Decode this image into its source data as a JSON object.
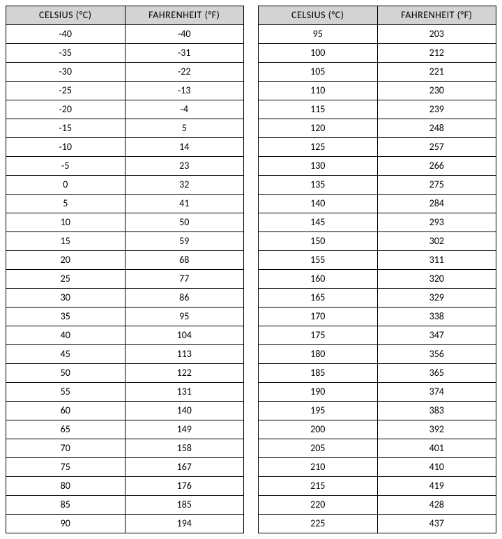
{
  "headers": {
    "celsius": "CELSIUS (°C)",
    "fahrenheit": "FAHRENHEIT (°F)"
  },
  "table_left": [
    {
      "c": "-40",
      "f": "-40"
    },
    {
      "c": "-35",
      "f": "-31"
    },
    {
      "c": "-30",
      "f": "-22"
    },
    {
      "c": "-25",
      "f": "-13"
    },
    {
      "c": "-20",
      "f": "-4"
    },
    {
      "c": "-15",
      "f": "5"
    },
    {
      "c": "-10",
      "f": "14"
    },
    {
      "c": "-5",
      "f": "23"
    },
    {
      "c": "0",
      "f": "32"
    },
    {
      "c": "5",
      "f": "41"
    },
    {
      "c": "10",
      "f": "50"
    },
    {
      "c": "15",
      "f": "59"
    },
    {
      "c": "20",
      "f": "68"
    },
    {
      "c": "25",
      "f": "77"
    },
    {
      "c": "30",
      "f": "86"
    },
    {
      "c": "35",
      "f": "95"
    },
    {
      "c": "40",
      "f": "104"
    },
    {
      "c": "45",
      "f": "113"
    },
    {
      "c": "50",
      "f": "122"
    },
    {
      "c": "55",
      "f": "131"
    },
    {
      "c": "60",
      "f": "140"
    },
    {
      "c": "65",
      "f": "149"
    },
    {
      "c": "70",
      "f": "158"
    },
    {
      "c": "75",
      "f": "167"
    },
    {
      "c": "80",
      "f": "176"
    },
    {
      "c": "85",
      "f": "185"
    },
    {
      "c": "90",
      "f": "194"
    }
  ],
  "table_right": [
    {
      "c": "95",
      "f": "203"
    },
    {
      "c": "100",
      "f": "212"
    },
    {
      "c": "105",
      "f": "221"
    },
    {
      "c": "110",
      "f": "230"
    },
    {
      "c": "115",
      "f": "239"
    },
    {
      "c": "120",
      "f": "248"
    },
    {
      "c": "125",
      "f": "257"
    },
    {
      "c": "130",
      "f": "266"
    },
    {
      "c": "135",
      "f": "275"
    },
    {
      "c": "140",
      "f": "284"
    },
    {
      "c": "145",
      "f": "293"
    },
    {
      "c": "150",
      "f": "302"
    },
    {
      "c": "155",
      "f": "311"
    },
    {
      "c": "160",
      "f": "320"
    },
    {
      "c": "165",
      "f": "329"
    },
    {
      "c": "170",
      "f": "338"
    },
    {
      "c": "175",
      "f": "347"
    },
    {
      "c": "180",
      "f": "356"
    },
    {
      "c": "185",
      "f": "365"
    },
    {
      "c": "190",
      "f": "374"
    },
    {
      "c": "195",
      "f": "383"
    },
    {
      "c": "200",
      "f": "392"
    },
    {
      "c": "205",
      "f": "401"
    },
    {
      "c": "210",
      "f": "410"
    },
    {
      "c": "215",
      "f": "419"
    },
    {
      "c": "220",
      "f": "428"
    },
    {
      "c": "225",
      "f": "437"
    }
  ]
}
